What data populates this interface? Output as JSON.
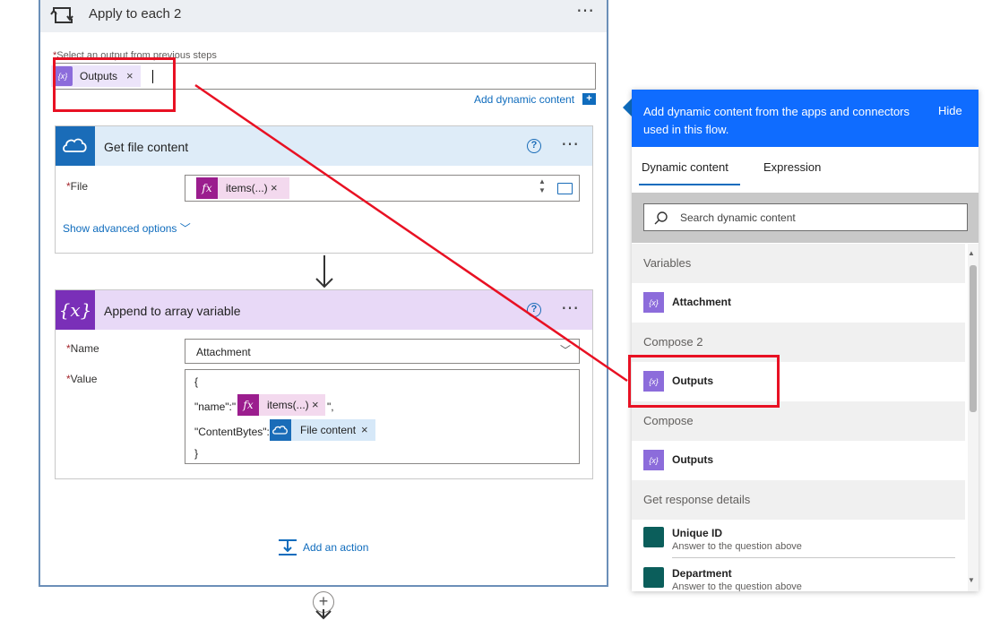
{
  "loop": {
    "title": "Apply to each 2",
    "more_label": "⋯",
    "select_label": "Select an output from previous steps",
    "required_mark": "*",
    "token_label": "Outputs",
    "token_icon_text": "{x}",
    "token_close": "×",
    "add_dynamic_label": "Add dynamic content",
    "add_dynamic_btn": "+"
  },
  "get_file_card": {
    "title": "Get file content",
    "help": "?",
    "more_label": "⋯",
    "file_label": "File",
    "required_mark": "*",
    "token_icon": "fx",
    "token_label": "items(...)",
    "token_close": "×",
    "spin": "▲\n▼",
    "show_advanced": "Show advanced options ﹀",
    "icon": "onedrive-cloud-icon"
  },
  "append_card": {
    "title": "Append to array variable",
    "icon_text": "{x}",
    "help": "?",
    "more_label": "⋯",
    "name_label": "Name",
    "required_mark": "*",
    "name_value": "Attachment",
    "name_chevron": "﹀",
    "value_label": "Value",
    "value_open": "{",
    "value_name_key": "\"name\":\"",
    "value_token1_icon": "fx",
    "value_token1_label": "items(...)",
    "value_token1_close": "×",
    "value_name_tail": "\",",
    "value_cb_key": "\"ContentBytes\":",
    "value_token2_label": "File content",
    "value_token2_close": "×",
    "value_close": "}"
  },
  "add_action": {
    "label": "Add an action"
  },
  "add_step": {
    "plus": "+"
  },
  "panel": {
    "header_text": "Add dynamic content from the apps and connectors used in this flow.",
    "hide_label": "Hide",
    "tabs": [
      {
        "label": "Dynamic content",
        "active": true
      },
      {
        "label": "Expression",
        "active": false
      }
    ],
    "search_placeholder": "Search dynamic content",
    "sections": [
      {
        "header": "Variables",
        "items": [
          {
            "label": "Attachment",
            "icon_text": "{x}"
          }
        ]
      },
      {
        "header": "Compose 2",
        "items": [
          {
            "label": "Outputs",
            "icon_text": "{x}"
          }
        ]
      },
      {
        "header": "Compose",
        "items": [
          {
            "label": "Outputs",
            "icon_text": "{x}"
          }
        ]
      },
      {
        "header": "Get response details",
        "items": [
          {
            "label": "Unique ID",
            "sub": "Answer to the question above"
          },
          {
            "label": "Department",
            "sub": "Answer to the question above"
          }
        ]
      }
    ],
    "scroll_up": "▲",
    "scroll_down": "▼"
  },
  "colors": {
    "annotation_red": "#e81123",
    "accent_blue": "#0f6cbd",
    "panel_header": "#0f6cff",
    "variable_purple": "#8c6cdb"
  }
}
